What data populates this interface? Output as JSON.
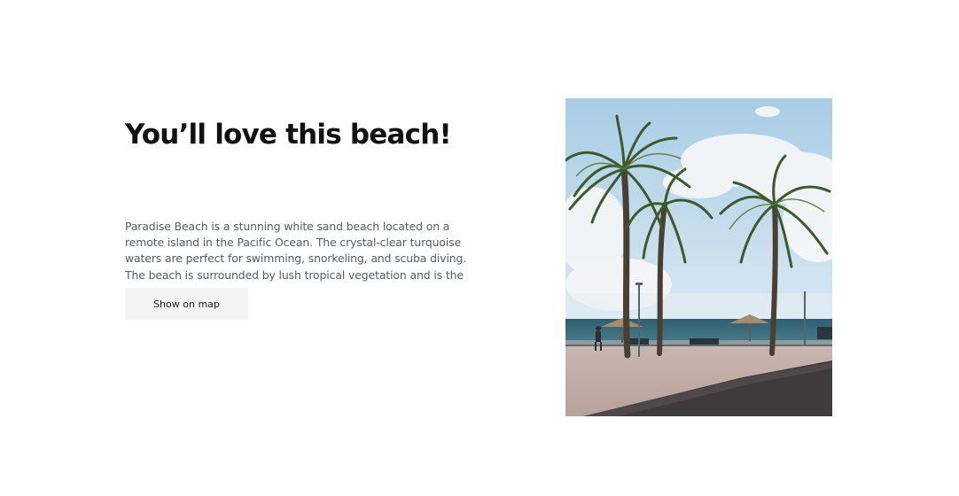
{
  "hero": {
    "title": "You’ll love this beach!",
    "description": "Paradise Beach is a stunning white sand beach located on a remote island in the Pacific Ocean. The crystal-clear turquoise waters are perfect for swimming, snorkeling, and scuba diving. The beach is surrounded by lush tropical vegetation and is the perfect place to relax and unwind.",
    "button_label": "Show on map"
  },
  "colors": {
    "title": "#111111",
    "body_text": "#555a66",
    "button_bg": "#f4f4f4"
  }
}
